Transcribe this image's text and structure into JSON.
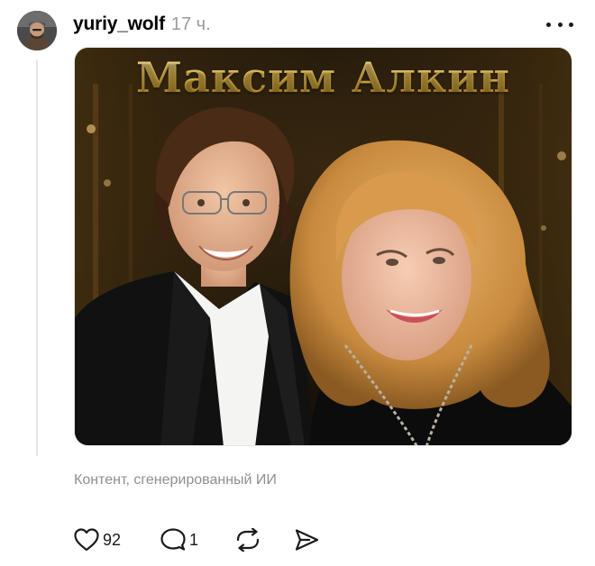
{
  "post": {
    "username": "yuriy_wolf",
    "timestamp": "17 ч.",
    "image": {
      "title": "Максим Алкин"
    },
    "ai_label": "Контент, сгенерированный ИИ",
    "actions": {
      "likes": "92",
      "comments": "1"
    }
  },
  "icons": {
    "more": "more-dots-icon",
    "like": "heart-icon",
    "comment": "comment-bubble-icon",
    "repost": "repost-arrows-icon",
    "share": "send-plane-icon"
  },
  "colors": {
    "text": "#000000",
    "muted": "#8f8f8f",
    "timestamp": "#9a9a9a",
    "gold": "#e8c25a",
    "thread_line": "#e5e5e5"
  }
}
